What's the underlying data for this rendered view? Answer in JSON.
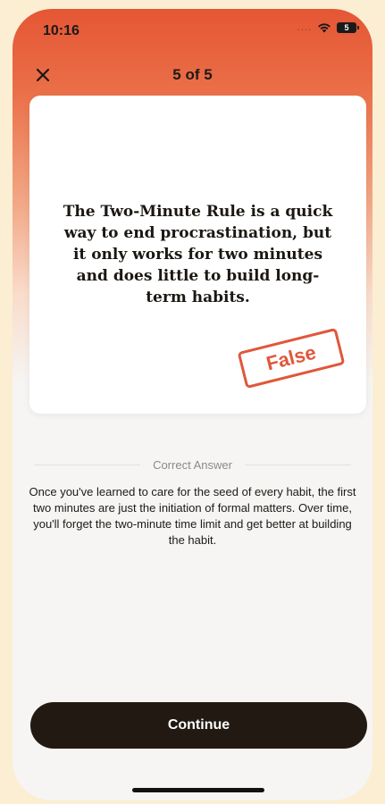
{
  "status_bar": {
    "time": "10:16",
    "signal": "....",
    "battery": "5"
  },
  "nav": {
    "progress": "5 of 5",
    "close_icon": "close-icon"
  },
  "card": {
    "statement": "The Two-Minute Rule is a quick way to end procrastination, but it only works for two minutes and does little to build long-term habits.",
    "stamp": "False"
  },
  "answer": {
    "label": "Correct Answer",
    "explanation": "Once you've learned to care for the seed of every habit, the first two minutes are just the initiation of formal matters. Over time, you'll forget the two-minute time limit and get better at building the habit."
  },
  "footer": {
    "continue_label": "Continue"
  },
  "colors": {
    "accent": "#e0573a",
    "header_top": "#e55634",
    "button": "#221a12",
    "background": "#f6f5f3"
  }
}
